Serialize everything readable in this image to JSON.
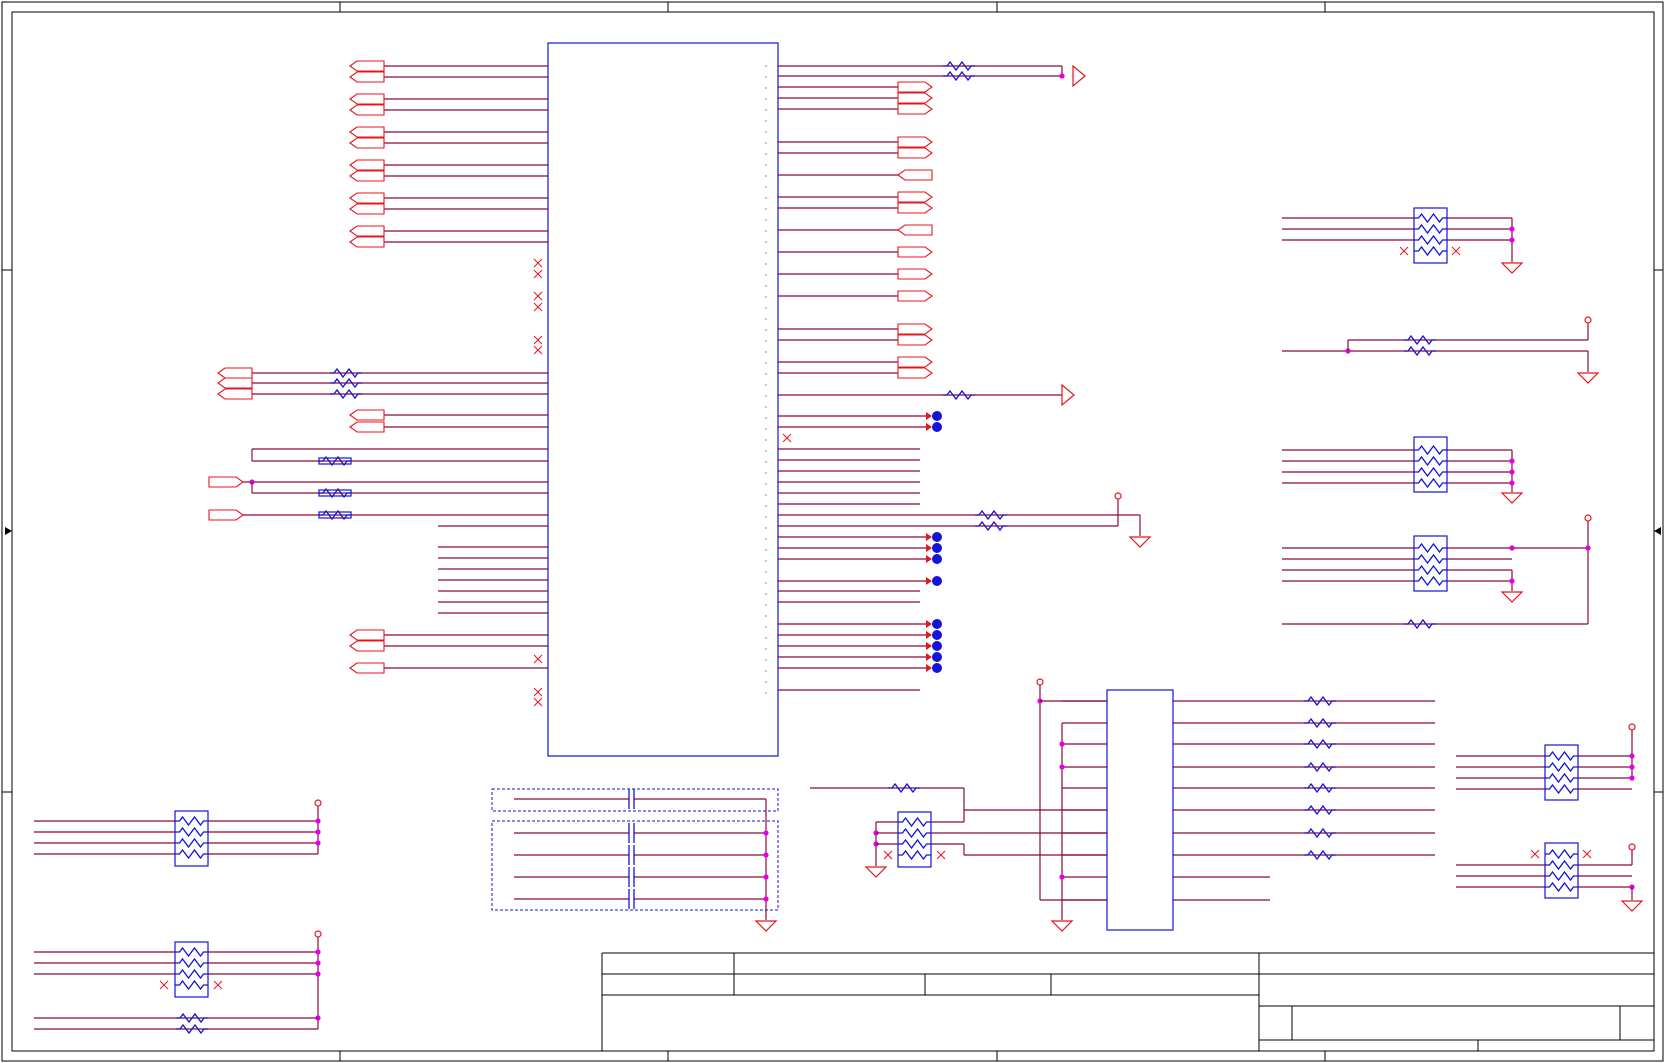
{
  "colors": {
    "wire": "#8b0a3a",
    "port": "#e8141e",
    "part": "#1414d6",
    "junction": "#e600e6",
    "frame": "#000000"
  },
  "frame": {
    "zones_columns": 5,
    "zones_rows": 4
  },
  "symbols": {
    "main_ic": "ic-block-icon",
    "secondary_ic": "ic-block-icon",
    "resistor": "resistor-icon",
    "resistor_pack": "resistor-network-icon",
    "ground": "ground-icon",
    "power": "power-pin-icon",
    "port": "port-arrow-icon",
    "testpoint": "test-point-icon",
    "no_connect": "no-connect-icon"
  },
  "title_block": {
    "fields": []
  }
}
